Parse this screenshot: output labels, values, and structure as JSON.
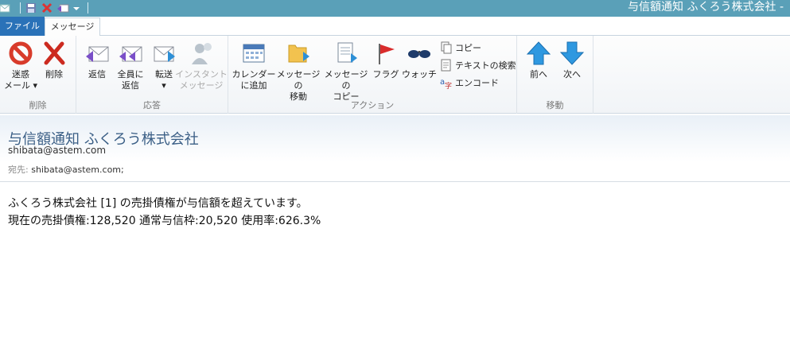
{
  "window": {
    "title": "与信額通知 ふくろう株式会社 -"
  },
  "tabs": {
    "file": "ファイル",
    "message": "メッセージ"
  },
  "ribbon": {
    "groups": {
      "delete": "削除",
      "respond": "応答",
      "actions": "アクション",
      "move": "移動"
    },
    "buttons": {
      "junk": "迷惑\nメール ▾",
      "delete": "削除",
      "reply": "返信",
      "reply_all": "全員に\n返信",
      "forward": "転送\n▾",
      "instant_message": "インスタント\nメッセージ",
      "add_to_calendar": "カレンダー\nに追加",
      "move_message": "メッセージの\n移動",
      "copy_message": "メッセージの\nコピー",
      "flag": "フラグ",
      "watch": "ウォッチ",
      "copy": "コピー",
      "find_text": "テキストの検索",
      "encode": "エンコード",
      "previous": "前へ",
      "next": "次へ"
    }
  },
  "message": {
    "subject": "与信額通知 ふくろう株式会社",
    "from": "shibata@astem.com",
    "to_label": "宛先:",
    "to": "shibata@astem.com;",
    "body_line1": "ふくろう株式会社 [1] の売掛債権が与信額を超えています。",
    "body_line2": "現在の売掛債権:128,520 通常与信枠:20,520 使用率:626.3%"
  }
}
